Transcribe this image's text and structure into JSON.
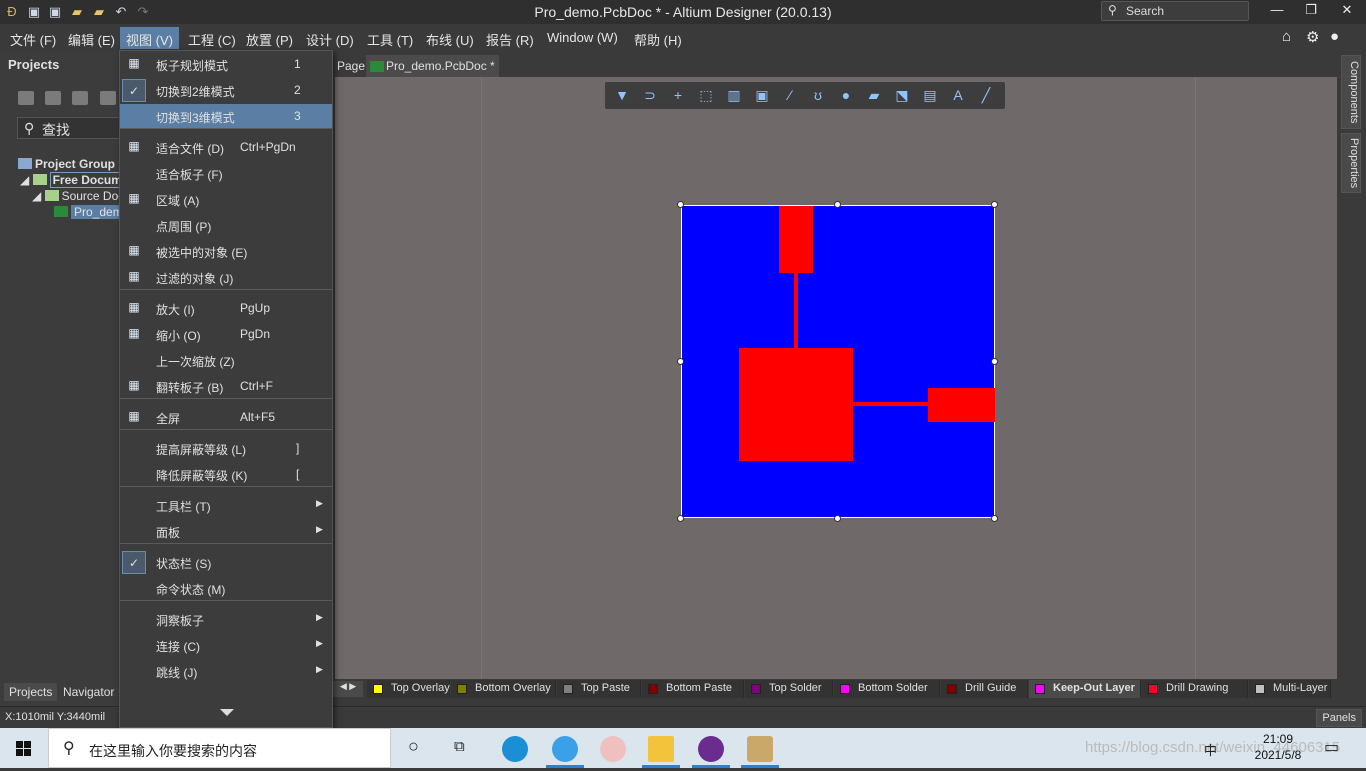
{
  "titlebar": {
    "title": "Pro_demo.PcbDoc * - Altium Designer (20.0.13)",
    "search_placeholder": "Search",
    "icons": [
      "altium-logo-icon",
      "save-icon",
      "save-all-icon",
      "open-icon",
      "open-project-icon",
      "undo-icon",
      "redo-icon"
    ]
  },
  "menubar": {
    "items": [
      "文件 (F)",
      "编辑 (E)",
      "视图 (V)",
      "工程 (C)",
      "放置 (P)",
      "设计 (D)",
      "工具 (T)",
      "布线 (U)",
      "报告 (R)",
      "Window (W)",
      "帮助 (H)"
    ],
    "active": "视图 (V)"
  },
  "left_panel": {
    "title": "Projects",
    "search_placeholder": "查找",
    "tree": [
      "Project Group 1.",
      "Free Documer",
      "Source Docu",
      "Pro_demo"
    ],
    "tabs": [
      "Projects",
      "Navigator"
    ]
  },
  "doc_tabs": [
    "Page",
    "Pro_demo.PcbDoc *"
  ],
  "view_menu": {
    "items": [
      {
        "label": "板子规划模式",
        "num": "1",
        "icon": "board-planning-icon"
      },
      {
        "label": "切换到2维模式",
        "num": "2",
        "checked": true
      },
      {
        "label": "切换到3维模式",
        "num": "3",
        "highlighted": true
      },
      {
        "label": "适合文件 (D)",
        "shortcut": "Ctrl+PgDn",
        "icon": "fit-document-icon"
      },
      {
        "label": "适合板子 (F)"
      },
      {
        "label": "区域 (A)",
        "icon": "zoom-area-icon"
      },
      {
        "label": "点周围 (P)"
      },
      {
        "label": "被选中的对象 (E)",
        "icon": "selected-objects-icon"
      },
      {
        "label": "过滤的对象 (J)",
        "icon": "filtered-objects-icon"
      },
      {
        "label": "放大 (I)",
        "shortcut": "PgUp",
        "icon": "zoom-in-icon"
      },
      {
        "label": "缩小 (O)",
        "shortcut": "PgDn",
        "icon": "zoom-out-icon"
      },
      {
        "label": "上一次缩放 (Z)"
      },
      {
        "label": "翻转板子 (B)",
        "shortcut": "Ctrl+F",
        "icon": "flip-board-icon"
      },
      {
        "label": "全屏",
        "shortcut": "Alt+F5",
        "icon": "fullscreen-icon"
      },
      {
        "label": "提高屏蔽等级 (L)",
        "shortcut": "]"
      },
      {
        "label": "降低屏蔽等级 (K)",
        "shortcut": "["
      },
      {
        "label": "工具栏 (T)",
        "submenu": true
      },
      {
        "label": "面板",
        "submenu": true
      },
      {
        "label": "状态栏 (S)",
        "checked": true
      },
      {
        "label": "命令状态 (M)"
      },
      {
        "label": "洞察板子",
        "submenu": true
      },
      {
        "label": "连接 (C)",
        "submenu": true
      },
      {
        "label": "跳线 (J)",
        "submenu": true
      }
    ]
  },
  "layers": [
    {
      "name": "Top Overlay",
      "color": "#ffff00"
    },
    {
      "name": "Bottom Overlay",
      "color": "#808000"
    },
    {
      "name": "Top Paste",
      "color": "#808080"
    },
    {
      "name": "Bottom Paste",
      "color": "#800000"
    },
    {
      "name": "Top Solder",
      "color": "#800080"
    },
    {
      "name": "Bottom Solder",
      "color": "#ff00ff"
    },
    {
      "name": "Drill Guide",
      "color": "#800000"
    },
    {
      "name": "Keep-Out Layer",
      "color": "#ff00ff",
      "active": true
    },
    {
      "name": "Drill Drawing",
      "color": "#ff002a"
    },
    {
      "name": "Multi-Layer",
      "color": "#c0c0c0"
    }
  ],
  "status": {
    "coords": "X:1010mil Y:3440mil",
    "panels_label": "Panels"
  },
  "right_tabs": [
    "Components",
    "Properties"
  ],
  "colors": {
    "board": "#0000ff",
    "copper": "#ff0000",
    "canvas": "#6f6a69",
    "menu_highlight": "#5b7fa4"
  },
  "taskbar": {
    "search_placeholder": "在这里输入你要搜索的内容",
    "time": "21:09",
    "date": "2021/5/8",
    "ime": "中",
    "watermark": "https://blog.csdn.net/weixin_44606315"
  }
}
